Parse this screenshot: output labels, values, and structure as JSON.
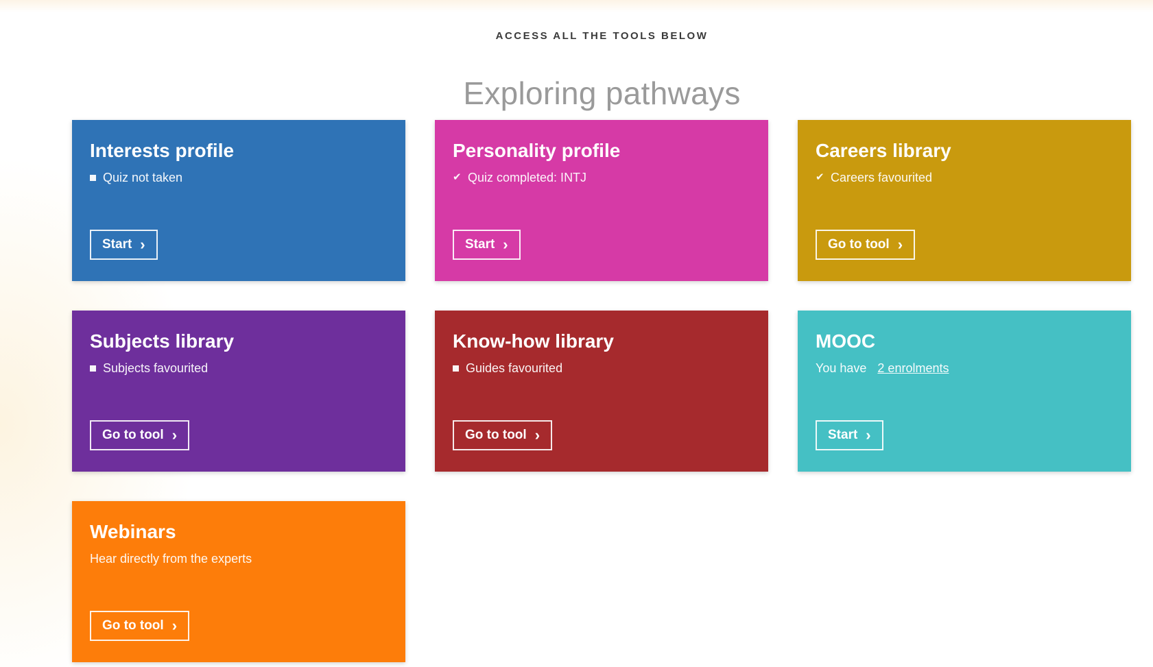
{
  "header": {
    "eyebrow": "ACCESS ALL THE TOOLS BELOW",
    "title": "Exploring pathways"
  },
  "cards": [
    {
      "title": "Interests profile",
      "status": "Quiz not taken",
      "status_icon": "square-icon",
      "button": "Start",
      "color": "#2f73b6"
    },
    {
      "title": "Personality profile",
      "status": "Quiz completed: INTJ",
      "status_icon": "check-icon",
      "button": "Start",
      "color": "#d63aa6"
    },
    {
      "title": "Careers library",
      "status": "Careers favourited",
      "status_icon": "check-icon",
      "button": "Go to tool",
      "color": "#c99a0e"
    },
    {
      "title": "Subjects library",
      "status": "Subjects favourited",
      "status_icon": "square-icon",
      "button": "Go to tool",
      "color": "#6e2f9c"
    },
    {
      "title": "Know-how library",
      "status": "Guides favourited",
      "status_icon": "square-icon",
      "button": "Go to tool",
      "color": "#a62a2d"
    },
    {
      "title": "MOOC",
      "status": "You have",
      "status_link": "2 enrolments",
      "button": "Start",
      "color": "#45c0c4"
    },
    {
      "title": "Webinars",
      "status": "Hear directly from the experts",
      "button": "Go to tool",
      "color": "#fd7d0a"
    }
  ]
}
